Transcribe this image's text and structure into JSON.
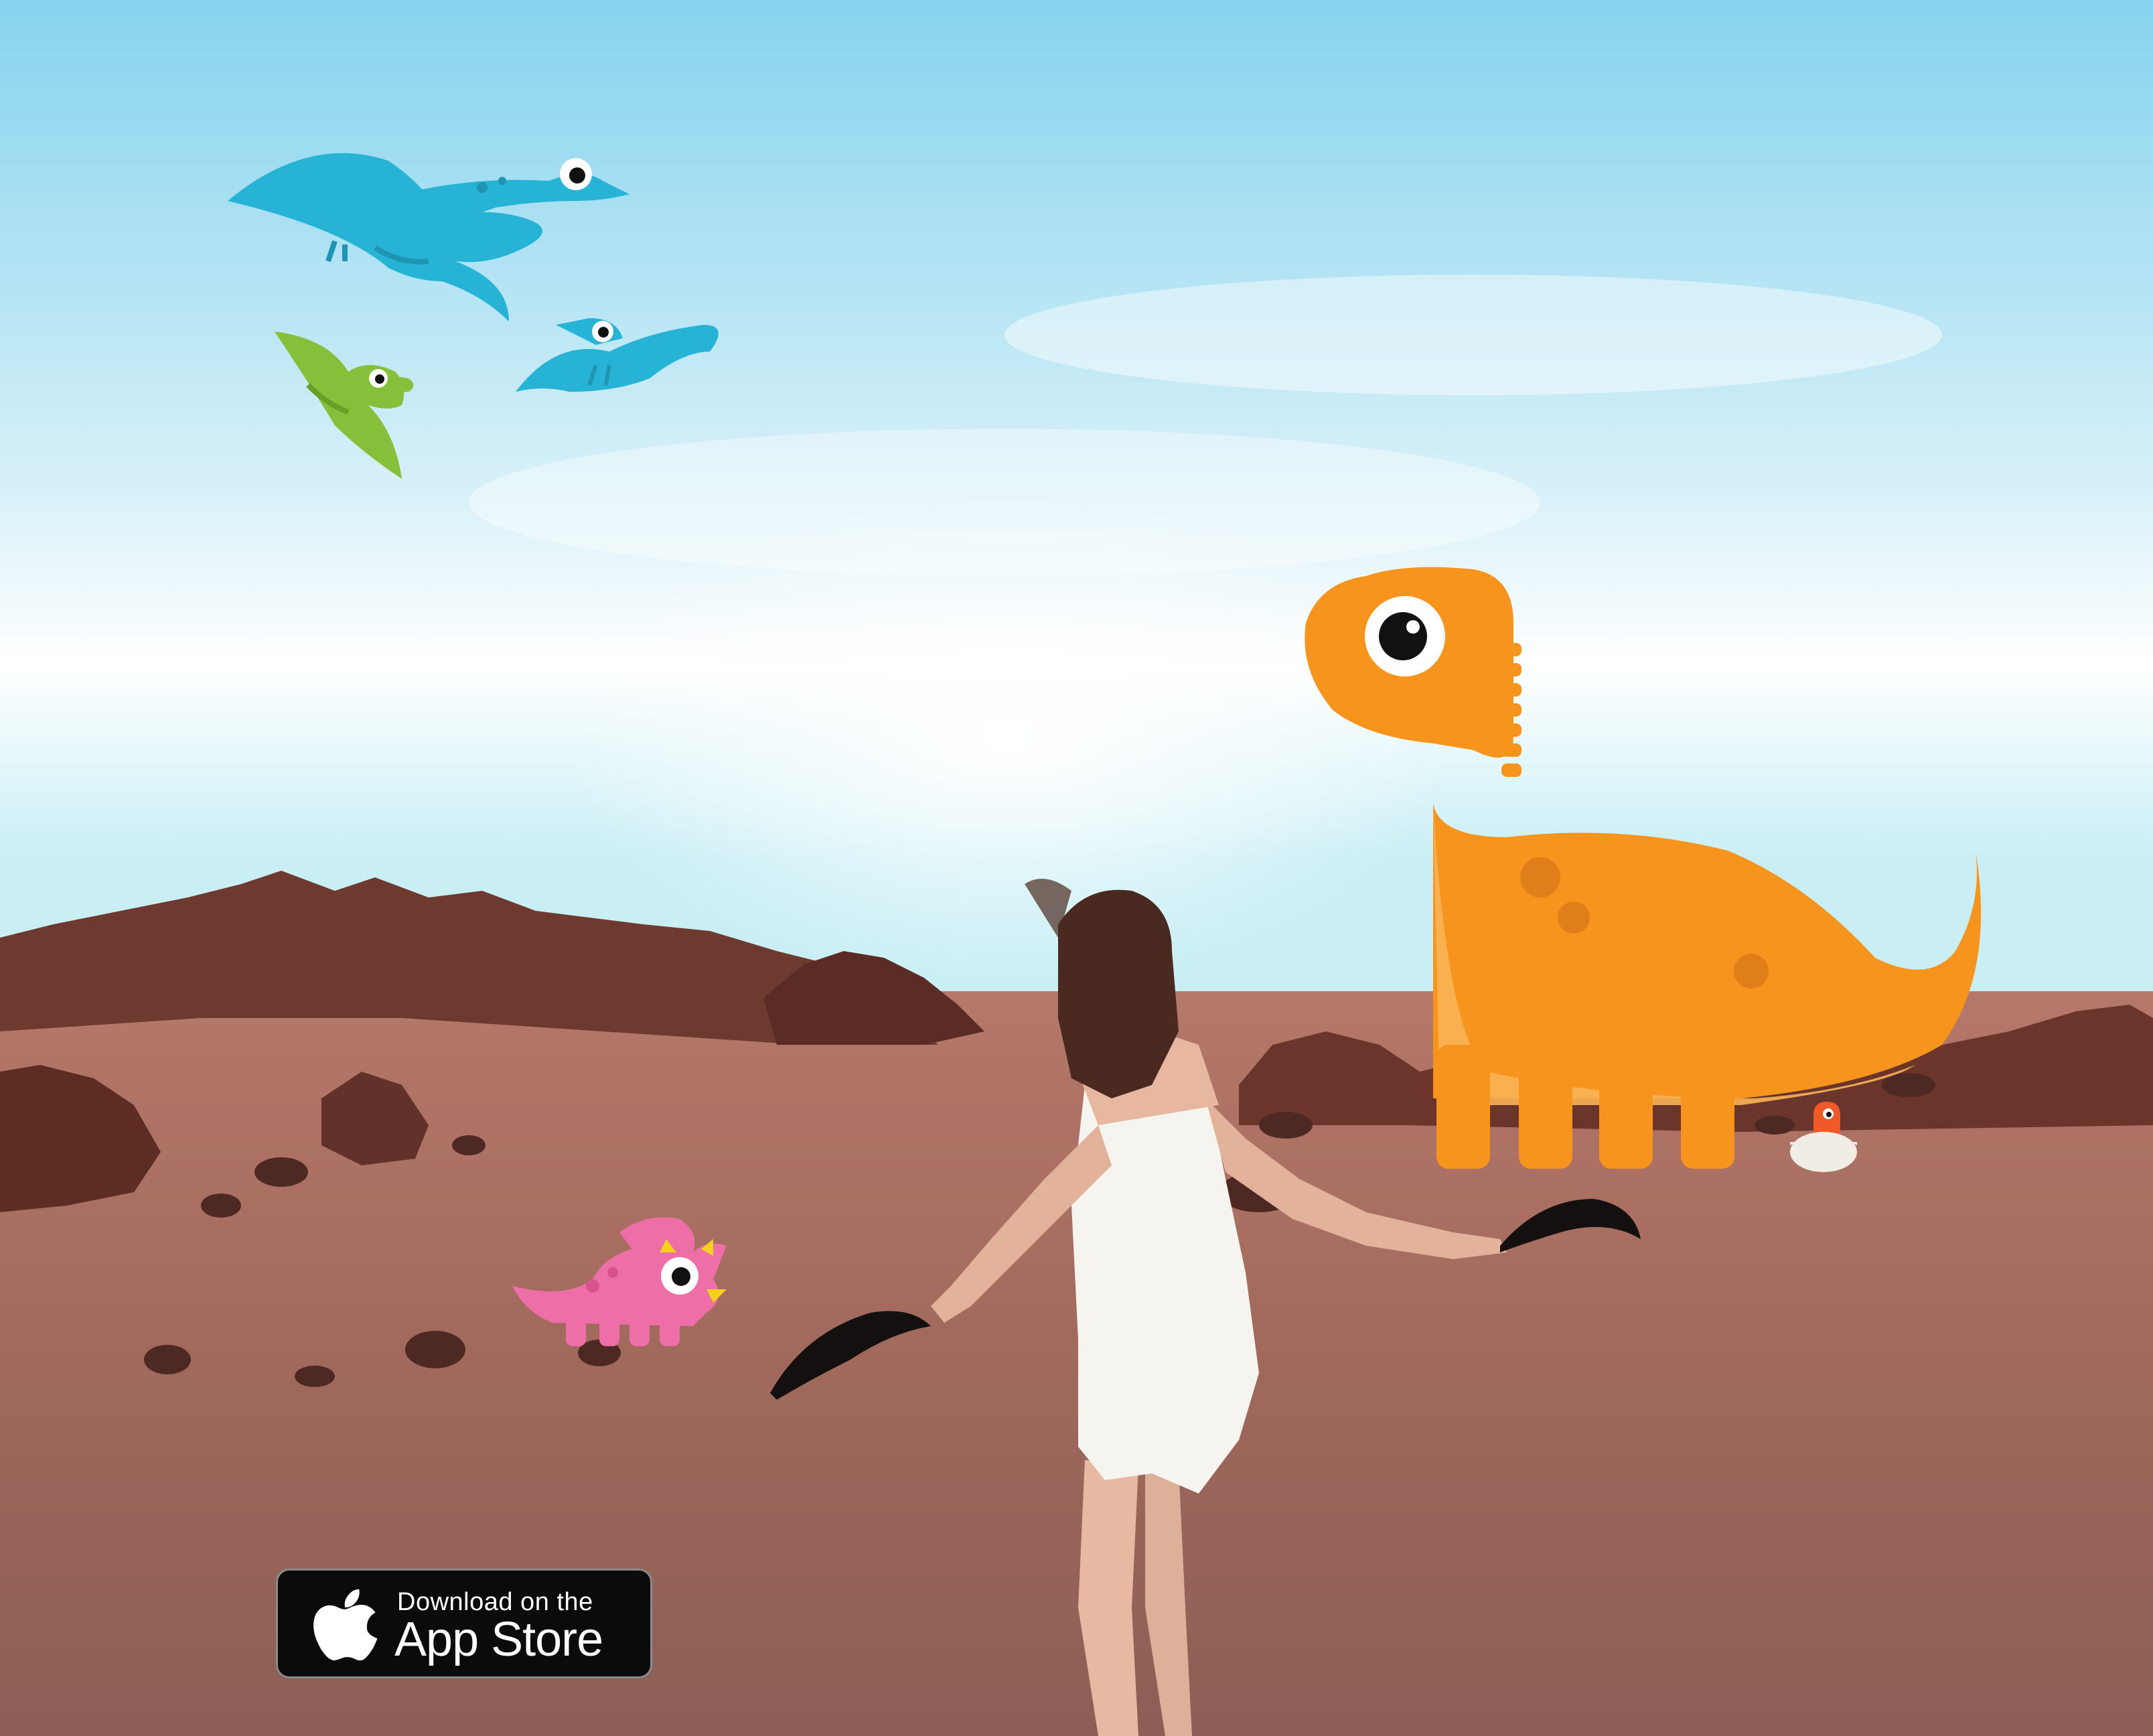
{
  "app_store_badge": {
    "line1": "Download on the",
    "line2": "App Store",
    "icon": "apple-icon"
  },
  "illustrations": [
    {
      "name": "pterodactyl-large",
      "color": "#27b3d6"
    },
    {
      "name": "pterodactyl-small",
      "color": "#27b3d6"
    },
    {
      "name": "pterodactyl-green",
      "color": "#86bf3a"
    },
    {
      "name": "brontosaurus",
      "color": "#f7941d"
    },
    {
      "name": "triceratops",
      "color": "#ee6fa7"
    },
    {
      "name": "hatching-egg",
      "color": "#f05a28"
    }
  ],
  "colors": {
    "sky_top": "#7fd6f0",
    "sky_bottom": "#f4fbfd",
    "desert": "#a8705c",
    "rocks": "#6b3328"
  }
}
